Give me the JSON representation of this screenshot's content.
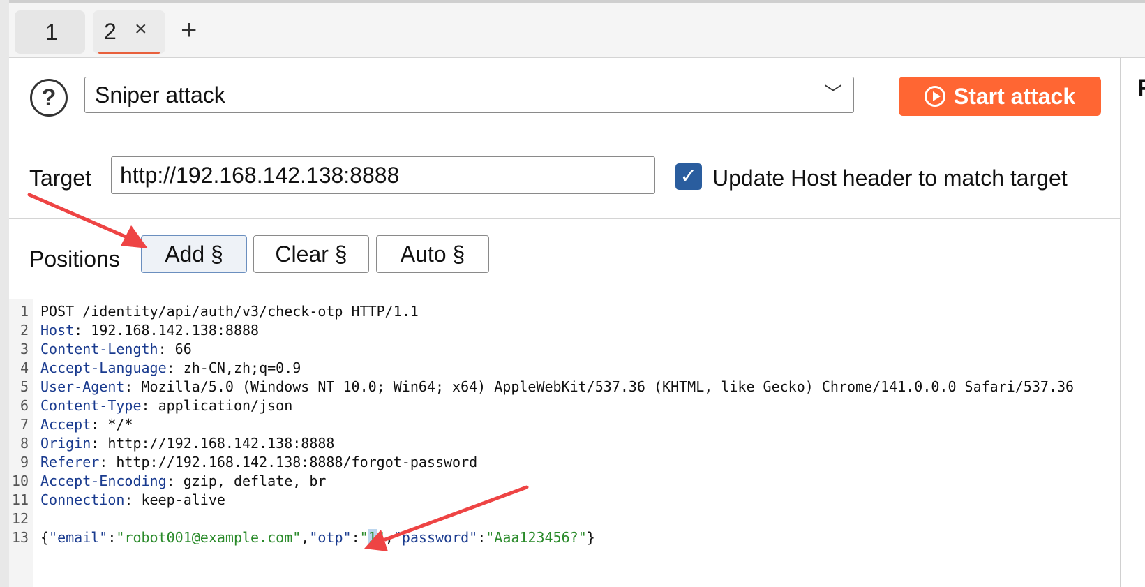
{
  "tabs": [
    {
      "label": "1"
    },
    {
      "label": "2",
      "close": "×"
    }
  ],
  "tab_add": "+",
  "attack": {
    "help_icon": "?",
    "type": "Sniper attack",
    "start_label": "Start attack",
    "accent": "#ff6633"
  },
  "target": {
    "label": "Target",
    "value": "http://192.168.142.138:8888",
    "checkbox_label": "Update Host header to match target",
    "checked": true
  },
  "positions": {
    "label": "Positions",
    "add": "Add §",
    "clear": "Clear §",
    "auto": "Auto §"
  },
  "right_panel_label": "P",
  "request": {
    "lines": [
      {
        "num": "1",
        "text": "POST /identity/api/auth/v3/check-otp HTTP/1.1"
      },
      {
        "num": "2",
        "key": "Host",
        "value": " 192.168.142.138:8888"
      },
      {
        "num": "3",
        "key": "Content-Length",
        "value": " 66"
      },
      {
        "num": "4",
        "key": "Accept-Language",
        "value": " zh-CN,zh;q=0.9"
      },
      {
        "num": "5",
        "key": "User-Agent",
        "value": " Mozilla/5.0 (Windows NT 10.0; Win64; x64) AppleWebKit/537.36 (KHTML, like Gecko) Chrome/141.0.0.0 Safari/537.36"
      },
      {
        "num": "6",
        "key": "Content-Type",
        "value": " application/json"
      },
      {
        "num": "7",
        "key": "Accept",
        "value": " */*"
      },
      {
        "num": "8",
        "key": "Origin",
        "value": " http://192.168.142.138:8888"
      },
      {
        "num": "9",
        "key": "Referer",
        "value": " http://192.168.142.138:8888/forgot-password"
      },
      {
        "num": "10",
        "key": "Accept-Encoding",
        "value": " gzip, deflate, br"
      },
      {
        "num": "11",
        "key": "Connection",
        "value": " keep-alive"
      },
      {
        "num": "12",
        "text": ""
      },
      {
        "num": "13",
        "text": ""
      }
    ],
    "body": {
      "open": "{",
      "k_email": "\"email\"",
      "colon": ":",
      "v_email": "\"robot001@example.com\"",
      "comma": ",",
      "k_otp": "\"otp\"",
      "q": "\"",
      "otp_value": "1",
      "k_password": "\"password\"",
      "v_password": "\"Aaa123456?\"",
      "close": "}"
    }
  }
}
